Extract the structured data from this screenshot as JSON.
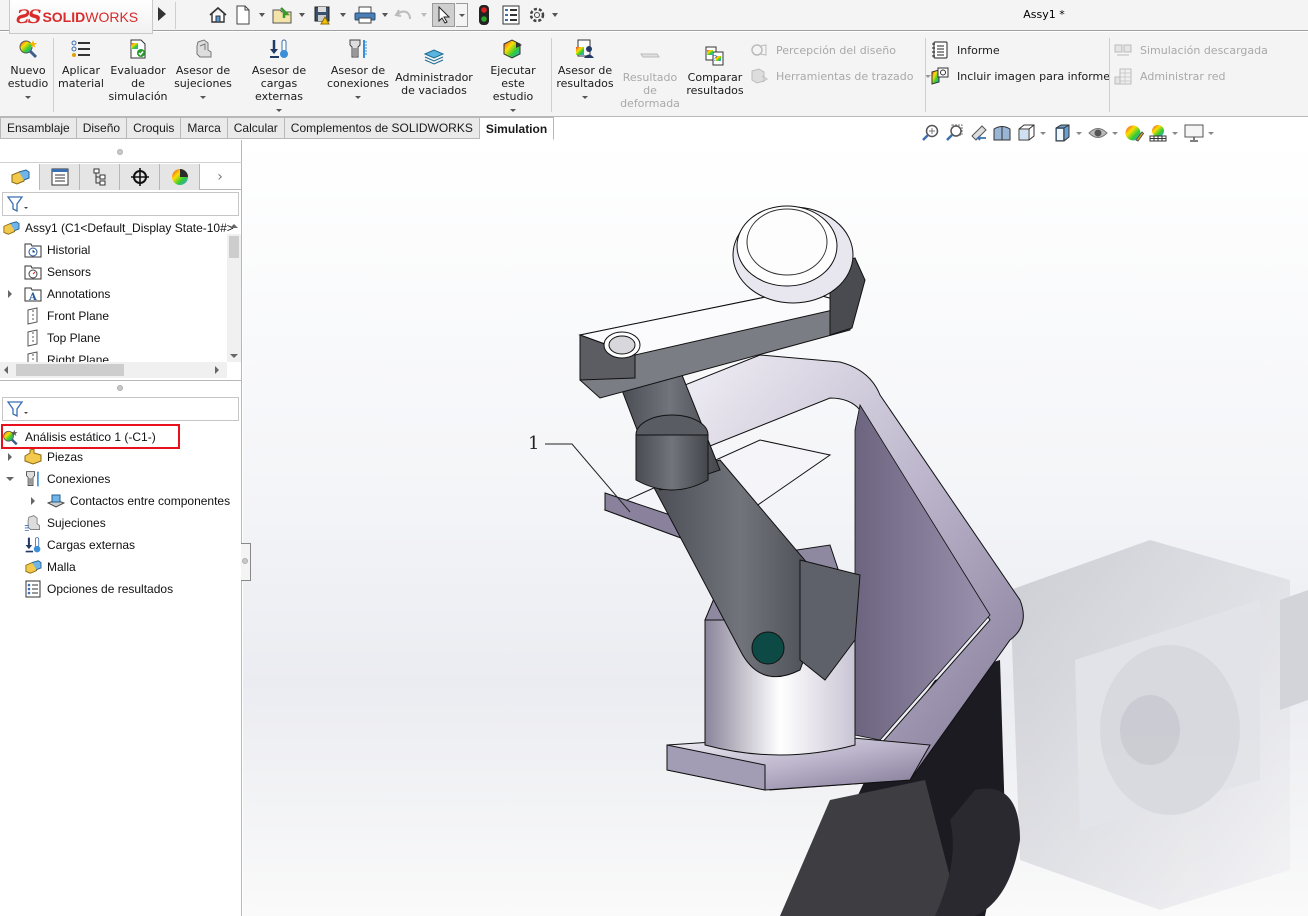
{
  "app": {
    "brand_prefix": "ƧS",
    "brand_bold": "SOLID",
    "brand_light": "WORKS",
    "document_title": "Assy1 *"
  },
  "quick_access": [
    {
      "name": "home",
      "icon": "home-icon"
    },
    {
      "name": "new",
      "icon": "new-document-icon"
    },
    {
      "name": "open",
      "icon": "open-folder-icon"
    },
    {
      "name": "save",
      "icon": "save-icon"
    },
    {
      "name": "print",
      "icon": "print-icon"
    },
    {
      "name": "undo",
      "icon": "undo-icon"
    },
    {
      "name": "select",
      "icon": "select-cursor-icon"
    },
    {
      "name": "rebuild",
      "icon": "traffic-light-icon"
    },
    {
      "name": "file-properties",
      "icon": "file-properties-icon"
    },
    {
      "name": "options",
      "icon": "gear-icon"
    }
  ],
  "ribbon": {
    "nuevo_estudio": "Nuevo\nestudio",
    "aplicar_material": "Aplicar\nmaterial",
    "evaluador": "Evaluador\nde\nsimulación",
    "asesor_sujeciones": "Asesor de\nsujeciones",
    "asesor_cargas": "Asesor de\ncargas externas",
    "asesor_conexiones": "Asesor de\nconexiones",
    "admin_vaciados": "Administrador\nde vaciados",
    "ejecutar": "Ejecutar este\nestudio",
    "asesor_resultados": "Asesor de\nresultados",
    "resultado_deformada": "Resultado\nde\ndeformada",
    "comparar": "Comparar\nresultados",
    "percepcion": "Percepción del diseño",
    "herramientas_trazado": "Herramientas de trazado",
    "informe": "Informe",
    "incluir_imagen": "Incluir imagen para informe",
    "simulacion_descargada": "Simulación descargada",
    "administrar_red": "Administrar red"
  },
  "tabs": [
    {
      "label": "Ensamblaje",
      "active": false
    },
    {
      "label": "Diseño",
      "active": false
    },
    {
      "label": "Croquis",
      "active": false
    },
    {
      "label": "Marca",
      "active": false
    },
    {
      "label": "Calcular",
      "active": false
    },
    {
      "label": "Complementos de SOLIDWORKS",
      "active": false
    },
    {
      "label": "Simulation",
      "active": true
    }
  ],
  "feature_tree": {
    "root": "Assy1  (C1<Default_Display State-10#>",
    "items": [
      {
        "label": "Historial",
        "icon": "history-folder-icon",
        "expandable": false
      },
      {
        "label": "Sensors",
        "icon": "sensors-folder-icon",
        "expandable": false
      },
      {
        "label": "Annotations",
        "icon": "annotations-folder-icon",
        "expandable": true
      },
      {
        "label": "Front Plane",
        "icon": "plane-icon",
        "expandable": false
      },
      {
        "label": "Top Plane",
        "icon": "plane-icon",
        "expandable": false
      },
      {
        "label": "Right Plane",
        "icon": "plane-icon",
        "expandable": false
      }
    ]
  },
  "simulation_tree": {
    "study": "Análisis estático 1 (-C1-)",
    "items": [
      {
        "label": "Piezas",
        "level": 1,
        "expander": "right"
      },
      {
        "label": "Conexiones",
        "level": 1,
        "expander": "down"
      },
      {
        "label": "Contactos entre componentes",
        "level": 2,
        "expander": "right"
      },
      {
        "label": "Sujeciones",
        "level": 1,
        "expander": "none"
      },
      {
        "label": "Cargas externas",
        "level": 1,
        "expander": "none"
      },
      {
        "label": "Malla",
        "level": 1,
        "expander": "none"
      },
      {
        "label": "Opciones de resultados",
        "level": 1,
        "expander": "none"
      }
    ]
  },
  "viewport": {
    "balloon_label": "1"
  },
  "colors": {
    "brand_red": "#d82b2b",
    "highlight_red": "#e8101a",
    "part_purple": "#8a7f9e",
    "part_gray": "#5d5f66",
    "pin_teal": "#0e4a45"
  }
}
